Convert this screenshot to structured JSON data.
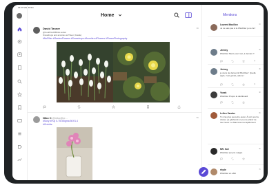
{
  "status_bar": {
    "time": "14:27 Mon 8 Nov",
    "battery": ""
  },
  "header": {
    "title": "Home"
  },
  "timeline": {
    "posts": [
      {
        "author": "David Tanner",
        "handle": "@CoolPicsOfBirds.social",
        "line1": "Snowdrops and aconites at Tilsen (Castle)",
        "tags": "#NoFilter #GardenFlowers #Snowdrops #Aconites #Flowers #FlowerPhotography",
        "time": "3h"
      },
      {
        "author": "Niko C",
        "handle": "@niko@cr...",
        "line1": "#Sony #Fuji X-T5 #Sigma 56 f/1.4",
        "tags": "#Orchids",
        "time": "5h"
      }
    ]
  },
  "mentions": {
    "title": "Mentions",
    "items": [
      {
        "name": "Laurent Mouillon",
        "handle": "@lmouillon",
        "text": "Je ne sais pas si le #NoFilter je ne fai !",
        "time": "1h",
        "reply_count": ""
      },
      {
        "name": "Jérémy",
        "handle": "@jeremyllc",
        "text": "#NoFilter Merci pour tout, à demain !!",
        "time": "2h",
        "reply_count": "1"
      },
      {
        "name": "Jérémy",
        "handle": "@jeremyllc",
        "text": "je viens de découvrir #NoFilter ! Quelle appli, c'est génial, j'adore !",
        "time": "3h",
        "reply_count": ""
      },
      {
        "name": "Yonek",
        "handle": "@yonek@m...",
        "text": "#NoFilter Propre le dashboard",
        "time": "4h",
        "reply_count": ""
      },
      {
        "name": "LeKen Sardon",
        "handle": "@lekensardon",
        "text": "Tu n'as plus peut-être aussi. À voir pour le clavier, ça gâcherait un peu le plaisir de tout revoir. Le Mac fera ma rapidement",
        "time": "5h",
        "reply_count": ""
      },
      {
        "name": "MR. Soll",
        "handle": "@mrsoll",
        "text": "#NoFilter j'ai pris malgré",
        "time": "6h",
        "reply_count": ""
      },
      {
        "name": "rhyde",
        "handle": "@rhyde@m...",
        "text": "#NoFilter en effet",
        "time": "7h",
        "reply_count": ""
      }
    ]
  },
  "icons": {
    "sidebar": [
      "home-icon",
      "notifications-icon",
      "profile-icon",
      "explore-icon",
      "search-icon",
      "favorites-icon",
      "bookmarks-icon",
      "messages-icon",
      "lists-icon",
      "tags-icon",
      "trending-icon"
    ],
    "accent": "#5b4ad6"
  }
}
